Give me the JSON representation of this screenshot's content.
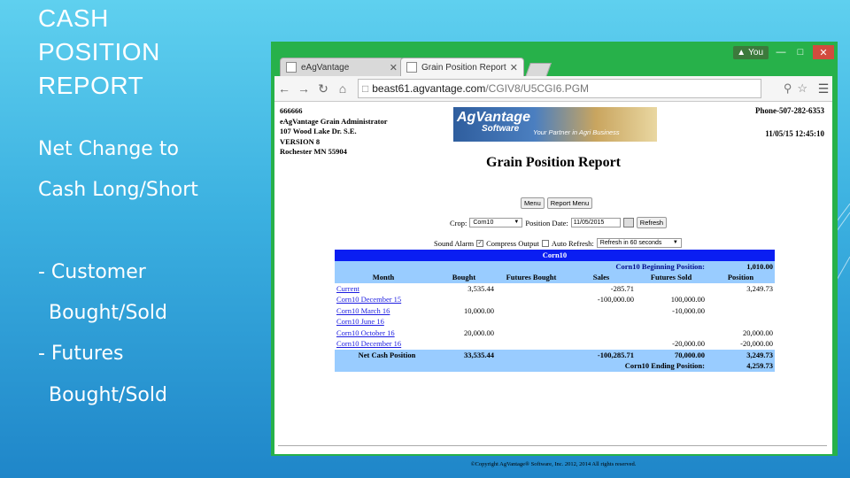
{
  "slide": {
    "title_lines": [
      "CASH",
      "POSITION",
      "REPORT"
    ],
    "subtitle_lines": [
      "Net Change to",
      "Cash Long/Short"
    ],
    "bullets": [
      "- Customer",
      "Bought/Sold",
      "- Futures",
      "Bought/Sold"
    ]
  },
  "browser": {
    "user_badge": "You",
    "tabs": [
      {
        "label": "eAgVantage",
        "active": false
      },
      {
        "label": "Grain Position Report",
        "active": true
      }
    ],
    "url_host": "beast61.agvantage.com",
    "url_path": "/CGIV8/U5CGI6.PGM"
  },
  "page": {
    "address_lines": [
      "666666",
      "eAgVantage Grain Administrator",
      "107 Wood Lake Dr. S.E.",
      "VERSION 8",
      "Rochester MN 55904"
    ],
    "phone": "Phone-507-282-6353",
    "datetime": "11/05/15 12:45:10",
    "logo_brand": "AgVantage",
    "logo_software": "Software",
    "logo_tagline": "Your Partner in Agri Business",
    "title": "Grain Position Report",
    "menu_button": "Menu",
    "report_menu_button": "Report Menu",
    "crop_label": "Crop:",
    "crop_value": "Corn10",
    "position_date_label": "Position Date:",
    "position_date_value": "11/05/2015",
    "refresh_button": "Refresh",
    "sound_alarm_label": "Sound Alarm",
    "compress_output_label": "Compress Output",
    "auto_refresh_label": "Auto Refresh:",
    "auto_refresh_value": "Refresh in 60 seconds",
    "footer": "©Copyright AgVantage® Software, Inc. 2012, 2014 All rights reserved."
  },
  "report": {
    "crop_header": "Corn10",
    "beginning_label": "Corn10 Beginning Position:",
    "beginning_value": "1,010.00",
    "columns": [
      "Month",
      "Bought",
      "Futures Bought",
      "Sales",
      "Futures Sold",
      "Position"
    ],
    "rows": [
      {
        "month": "Current",
        "bought": "3,535.44",
        "futures_bought": "",
        "sales": "-285.71",
        "futures_sold": "",
        "position": "3,249.73"
      },
      {
        "month": "Corn10 December 15",
        "bought": "",
        "futures_bought": "",
        "sales": "-100,000.00",
        "futures_sold": "100,000.00",
        "position": ""
      },
      {
        "month": "Corn10 March 16",
        "bought": "10,000.00",
        "futures_bought": "",
        "sales": "",
        "futures_sold": "-10,000.00",
        "position": ""
      },
      {
        "month": "Corn10 June 16",
        "bought": "",
        "futures_bought": "",
        "sales": "",
        "futures_sold": "",
        "position": ""
      },
      {
        "month": "Corn10 October 16",
        "bought": "20,000.00",
        "futures_bought": "",
        "sales": "",
        "futures_sold": "",
        "position": "20,000.00"
      },
      {
        "month": "Corn10 December 16",
        "bought": "",
        "futures_bought": "",
        "sales": "",
        "futures_sold": "-20,000.00",
        "position": "-20,000.00"
      }
    ],
    "net_label": "Net Cash Position",
    "net_bought": "33,535.44",
    "net_sales": "-100,285.71",
    "net_futures_sold": "70,000.00",
    "net_position": "3,249.73",
    "ending_label": "Corn10 Ending Position:",
    "ending_value": "4,259.73"
  }
}
